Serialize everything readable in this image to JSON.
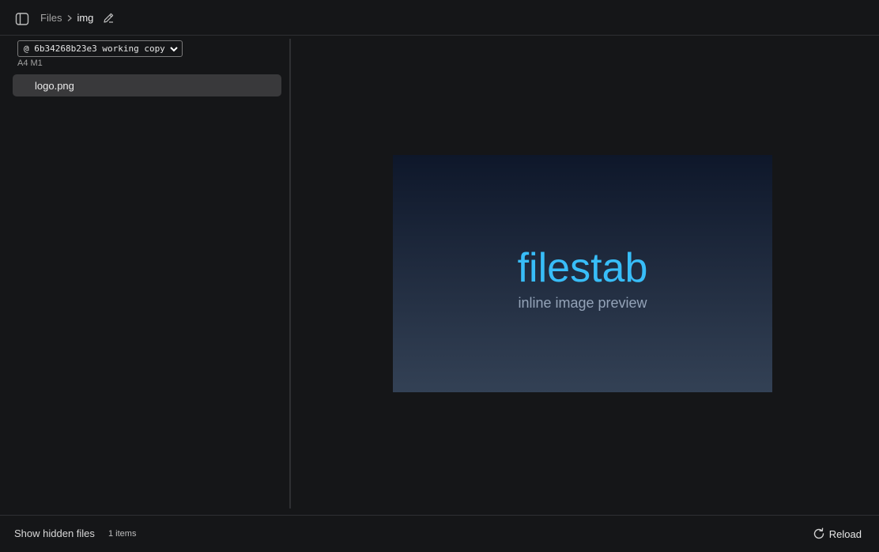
{
  "header": {
    "breadcrumb": [
      {
        "label": "Files"
      },
      {
        "label": "img"
      }
    ],
    "icons": {
      "sidebar_toggle": "sidebar-panel-icon",
      "separator": "chevron-right-icon",
      "edit": "pencil-icon"
    }
  },
  "sidebar": {
    "revision_select": {
      "selected": "@ 6b34268b23e3 working copy"
    },
    "change_summary": "A4 M1",
    "files": [
      {
        "name": "logo.png",
        "selected": true
      }
    ]
  },
  "preview": {
    "image_title": "filestab",
    "image_subtitle": "inline image preview",
    "colors": {
      "title": "#38bdf8",
      "subtitle": "#94a3b8",
      "gradient_top": "#0e172a",
      "gradient_bottom": "#334155"
    }
  },
  "footer": {
    "show_hidden_label": "Show hidden files",
    "item_count": "1 items",
    "reload_label": "Reload",
    "reload_icon": "refresh-icon"
  }
}
